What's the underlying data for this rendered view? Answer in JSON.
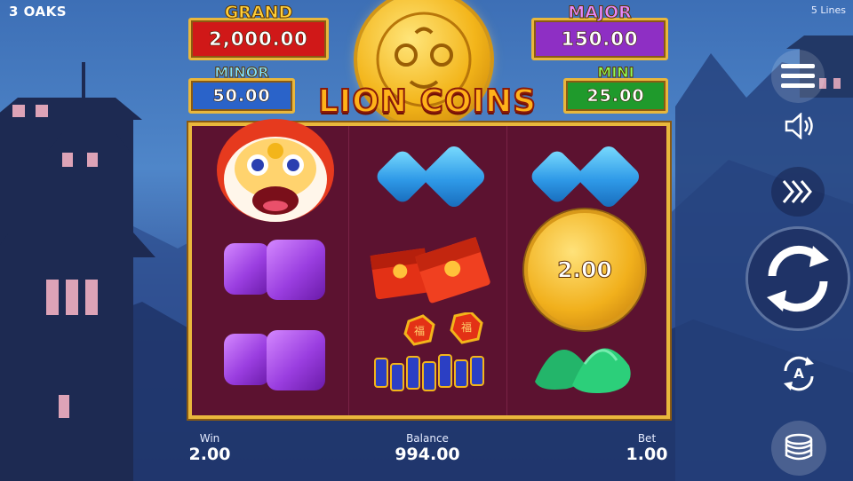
{
  "brand": "3 OAKS",
  "lines_label": "5 Lines",
  "game_title": "LION COINS",
  "jackpots": {
    "grand": {
      "title": "GRAND",
      "value": "2,000.00",
      "color": "#d01818"
    },
    "major": {
      "title": "MAJOR",
      "value": "150.00",
      "color": "#8e2fc4"
    },
    "minor": {
      "title": "MINOR",
      "value": "50.00",
      "color": "#2a63c9"
    },
    "mini": {
      "title": "MINI",
      "value": "25.00",
      "color": "#1f9a2c"
    }
  },
  "reels": {
    "coin_value": "2.00",
    "symbols": [
      [
        "lion-head",
        "purple-gem",
        "purple-gem"
      ],
      [
        "blue-gem",
        "red-envelope",
        "firecrackers"
      ],
      [
        "blue-gem",
        "gold-coin",
        "green-gem"
      ]
    ]
  },
  "stats": {
    "win": {
      "label": "Win",
      "value": "2.00"
    },
    "balance": {
      "label": "Balance",
      "value": "994.00"
    },
    "bet": {
      "label": "Bet",
      "value": "1.00"
    }
  },
  "controls": {
    "menu_icon": "hamburger-icon",
    "sound_icon": "speaker-icon",
    "turbo_icon": "fast-forward-icon",
    "spin_icon": "refresh-icon",
    "autoplay_label": "A",
    "bet_icon": "coin-stack-icon"
  }
}
